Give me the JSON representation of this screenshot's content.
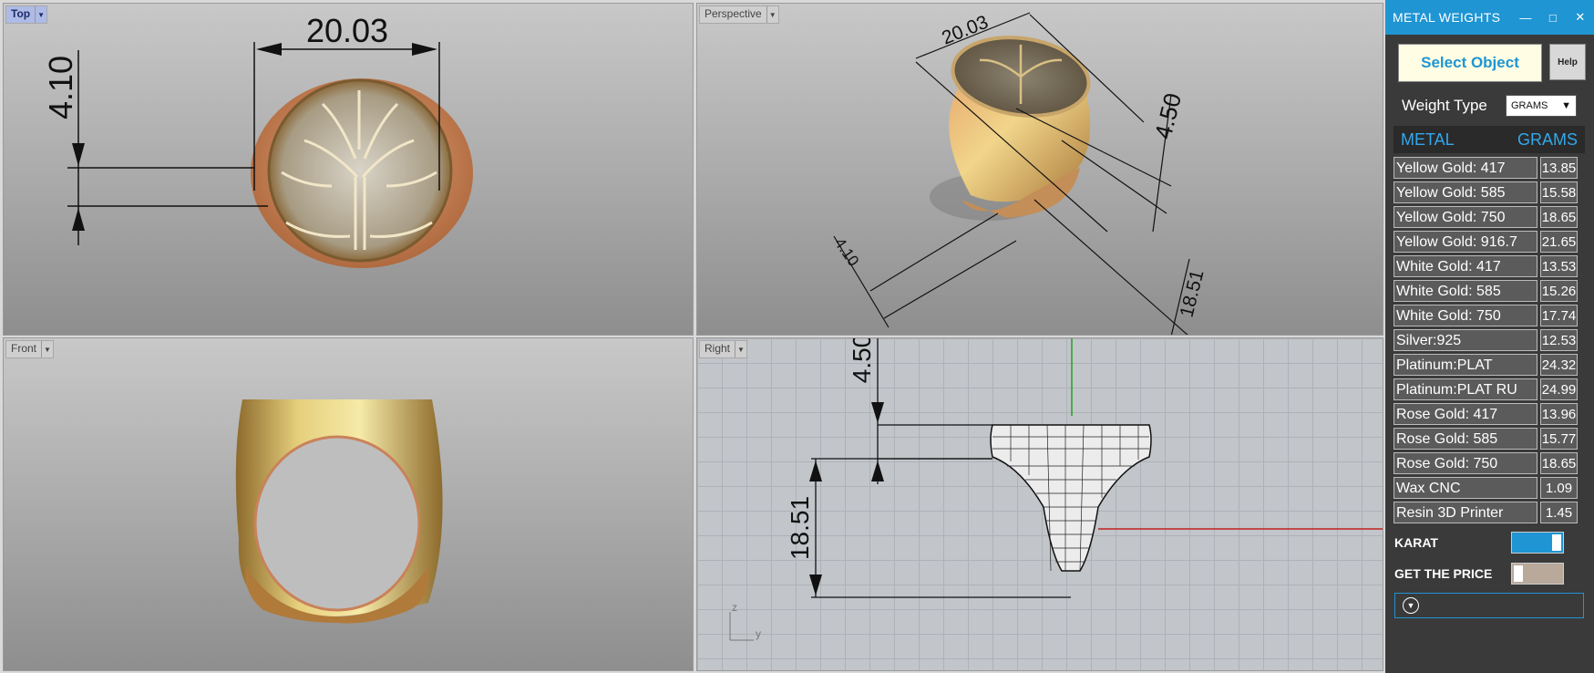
{
  "viewports": {
    "top": {
      "label": "Top"
    },
    "perspective": {
      "label": "Perspective"
    },
    "front": {
      "label": "Front"
    },
    "right": {
      "label": "Right"
    }
  },
  "dimensions": {
    "top_width": "20.03",
    "top_height": "4.10",
    "persp_width": "20.03",
    "persp_top": "4.50",
    "persp_side": "4.10",
    "persp_ring": "18.51",
    "right_top": "4.50",
    "right_ring": "18.51"
  },
  "axis_labels": {
    "z": "z",
    "y": "y"
  },
  "panel": {
    "title": "METAL WEIGHTS",
    "select_label": "Select Object",
    "help_label": "Help",
    "weight_type_label": "Weight Type",
    "weight_type_value": "GRAMS",
    "col_metal": "METAL",
    "col_grams": "GRAMS",
    "metals": [
      {
        "name": "Yellow Gold: 417",
        "grams": "13.85"
      },
      {
        "name": "Yellow Gold: 585",
        "grams": "15.58"
      },
      {
        "name": "Yellow Gold: 750",
        "grams": "18.65"
      },
      {
        "name": "Yellow Gold: 916.7",
        "grams": "21.65"
      },
      {
        "name": "White Gold: 417",
        "grams": "13.53"
      },
      {
        "name": "White Gold: 585",
        "grams": "15.26"
      },
      {
        "name": "White Gold: 750",
        "grams": "17.74"
      },
      {
        "name": "Silver:925",
        "grams": "12.53"
      },
      {
        "name": "Platinum:PLAT",
        "grams": "24.32"
      },
      {
        "name": "Platinum:PLAT RU",
        "grams": "24.99"
      },
      {
        "name": "Rose Gold: 417",
        "grams": "13.96"
      },
      {
        "name": "Rose Gold: 585",
        "grams": "15.77"
      },
      {
        "name": "Rose Gold: 750",
        "grams": "18.65"
      },
      {
        "name": "Wax  CNC",
        "grams": "1.09"
      },
      {
        "name": "Resin 3D Printer",
        "grams": "1.45"
      }
    ],
    "karat_label": "KARAT",
    "karat_on": true,
    "price_label": "GET THE PRICE",
    "price_on": false
  },
  "colors": {
    "accent": "#1f95d3",
    "panel_bg": "#3a3a3a",
    "gold": "#c9a24a",
    "rose": "#c9825a"
  },
  "icons": [
    "chevron-down-icon",
    "minimize-icon",
    "maximize-icon",
    "close-icon",
    "expand-circle-icon"
  ]
}
